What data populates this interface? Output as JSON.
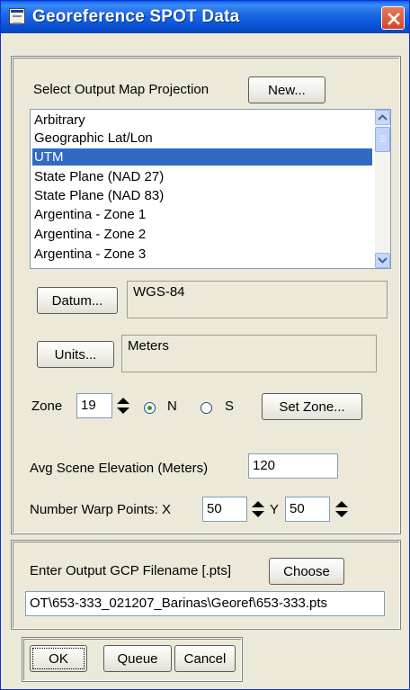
{
  "window": {
    "title": "Georeference SPOT Data"
  },
  "projection": {
    "label": "Select Output Map Projection",
    "new_button": "New...",
    "items": [
      "Arbitrary",
      "Geographic Lat/Lon",
      "UTM",
      "State Plane (NAD 27)",
      "State Plane (NAD 83)",
      "Argentina - Zone 1",
      "Argentina - Zone 2",
      "Argentina - Zone 3"
    ],
    "selected": "UTM"
  },
  "datum": {
    "button": "Datum...",
    "value": "WGS-84"
  },
  "units": {
    "button": "Units...",
    "value": "Meters"
  },
  "zone": {
    "label": "Zone",
    "value": "19",
    "north_label": "N",
    "south_label": "S",
    "hemisphere": "N",
    "set_button": "Set Zone..."
  },
  "elevation": {
    "label": "Avg Scene Elevation (Meters)",
    "value": "120"
  },
  "warp": {
    "label": "Number Warp Points: X",
    "x_value": "50",
    "y_label": "Y",
    "y_value": "50"
  },
  "output": {
    "label": "Enter Output GCP Filename [.pts]",
    "choose_button": "Choose",
    "filename": "OT\\653-333_021207_Barinas\\Georef\\653-333.pts"
  },
  "footer": {
    "ok": "OK",
    "queue": "Queue",
    "cancel": "Cancel"
  },
  "colors": {
    "title_bar": "#0a53d8",
    "selection": "#316ac5",
    "dialog_bg": "#ece9d8"
  }
}
